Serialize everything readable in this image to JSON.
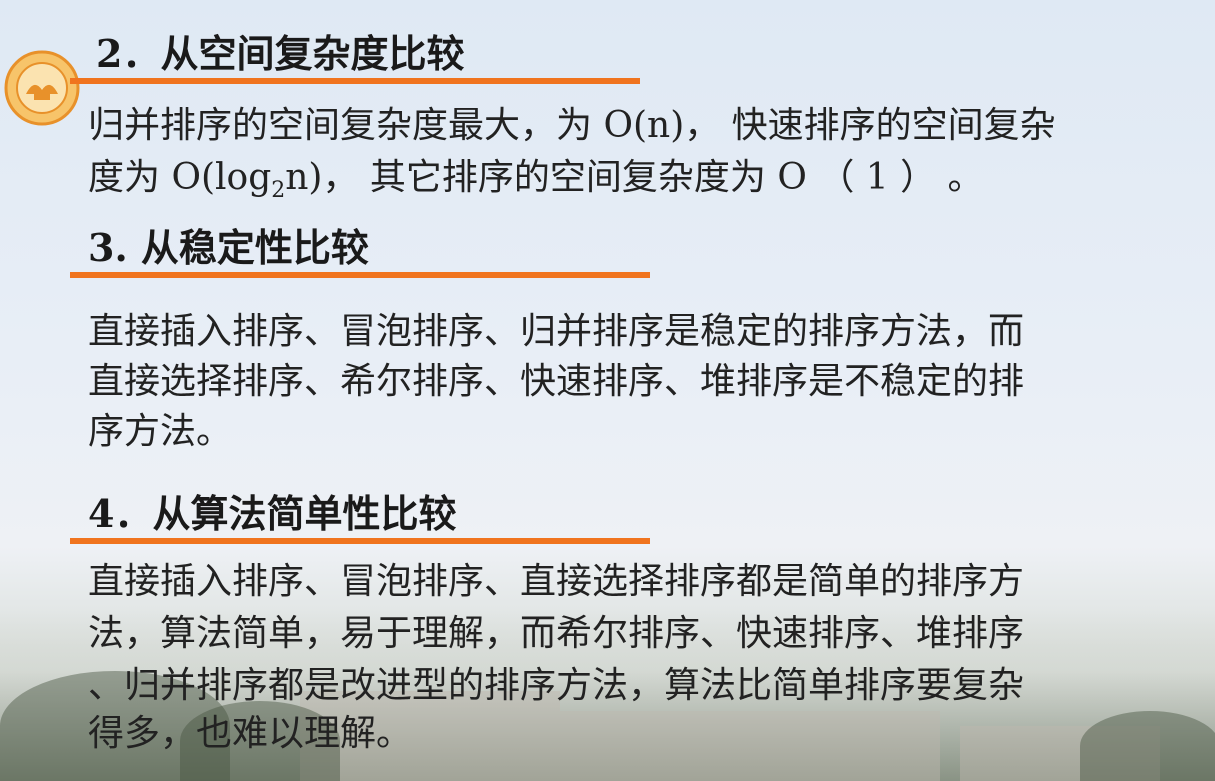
{
  "sections": [
    {
      "heading": "2．从空间复杂度比较",
      "lines": [
        {
          "pre": "归并排序的空间复杂度最大，为 O(n)， 快速排序的空间复杂",
          "sub": "",
          "post": ""
        },
        {
          "pre": "度为 O(log",
          "sub": "2",
          "post": "n)， 其它排序的空间复杂度为 O （ 1 ） 。"
        }
      ]
    },
    {
      "heading": "3. 从稳定性比较",
      "lines": [
        {
          "pre": "直接插入排序、冒泡排序、归并排序是稳定的排序方法，而",
          "sub": "",
          "post": ""
        },
        {
          "pre": "直接选择排序、希尔排序、快速排序、堆排序是不稳定的排",
          "sub": "",
          "post": ""
        },
        {
          "pre": "序方法。",
          "sub": "",
          "post": ""
        }
      ]
    },
    {
      "heading": "4．从算法简单性比较",
      "lines": [
        {
          "pre": "直接插入排序、冒泡排序、直接选择排序都是简单的排序方",
          "sub": "",
          "post": ""
        },
        {
          "pre": "法，算法简单，易于理解，而希尔排序、快速排序、堆排序",
          "sub": "",
          "post": ""
        },
        {
          "pre": "、归并排序都是改进型的排序方法，算法比简单排序要复杂",
          "sub": "",
          "post": ""
        },
        {
          "pre": "得多，也难以理解。",
          "sub": "",
          "post": ""
        }
      ]
    }
  ],
  "colors": {
    "accent": "#f0741e",
    "logo": "#f2a33a"
  }
}
